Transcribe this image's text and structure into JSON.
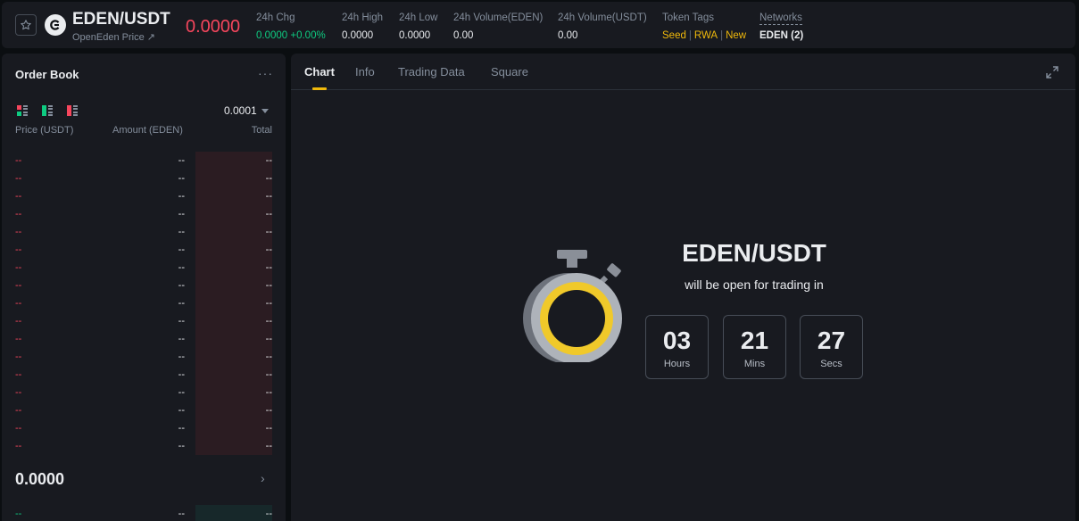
{
  "header": {
    "pair": "EDEN/USDT",
    "subtitle": "OpenEden Price",
    "subtitle_arrow": "↗",
    "last_price": "0.0000",
    "stats": [
      {
        "label": "24h Chg",
        "value": "0.0000 +0.00%"
      },
      {
        "label": "24h High",
        "value": "0.0000"
      },
      {
        "label": "24h Low",
        "value": "0.0000"
      },
      {
        "label": "24h Volume(EDEN)",
        "value": "0.00"
      },
      {
        "label": "24h Volume(USDT)",
        "value": "0.00"
      }
    ],
    "token_tags_label": "Token Tags",
    "token_tags": [
      "Seed",
      "RWA",
      "New"
    ],
    "networks_label": "Networks",
    "networks_value": "EDEN (2)",
    "icons": {
      "favorite": "star-icon",
      "logo": "openeden-logo-icon"
    },
    "colors": {
      "price_down": "#f6465d",
      "price_up": "#0ecb81",
      "tag": "#f0b90b"
    }
  },
  "orderbook": {
    "title": "Order Book",
    "more": "···",
    "step": "0.0001",
    "columns": {
      "price": "Price (USDT)",
      "amount": "Amount (EDEN)",
      "total": "Total"
    },
    "asks": [
      {
        "p": "--",
        "a": "--",
        "t": "--"
      },
      {
        "p": "--",
        "a": "--",
        "t": "--"
      },
      {
        "p": "--",
        "a": "--",
        "t": "--"
      },
      {
        "p": "--",
        "a": "--",
        "t": "--"
      },
      {
        "p": "--",
        "a": "--",
        "t": "--"
      },
      {
        "p": "--",
        "a": "--",
        "t": "--"
      },
      {
        "p": "--",
        "a": "--",
        "t": "--"
      },
      {
        "p": "--",
        "a": "--",
        "t": "--"
      },
      {
        "p": "--",
        "a": "--",
        "t": "--"
      },
      {
        "p": "--",
        "a": "--",
        "t": "--"
      },
      {
        "p": "--",
        "a": "--",
        "t": "--"
      },
      {
        "p": "--",
        "a": "--",
        "t": "--"
      },
      {
        "p": "--",
        "a": "--",
        "t": "--"
      },
      {
        "p": "--",
        "a": "--",
        "t": "--"
      },
      {
        "p": "--",
        "a": "--",
        "t": "--"
      },
      {
        "p": "--",
        "a": "--",
        "t": "--"
      },
      {
        "p": "--",
        "a": "--",
        "t": "--"
      }
    ],
    "mid_price": "0.0000",
    "mid_arrow": "›",
    "bid": {
      "p": "--",
      "a": "--",
      "t": "--"
    }
  },
  "chart_panel": {
    "tabs": [
      "Chart",
      "Info",
      "Trading Data",
      "Square"
    ],
    "active_tab": "Chart",
    "countdown": {
      "title": "EDEN/USDT",
      "subtitle": "will be open for trading in",
      "hours": "03",
      "hours_label": "Hours",
      "mins": "21",
      "mins_label": "Mins",
      "secs": "27",
      "secs_label": "Secs"
    }
  }
}
